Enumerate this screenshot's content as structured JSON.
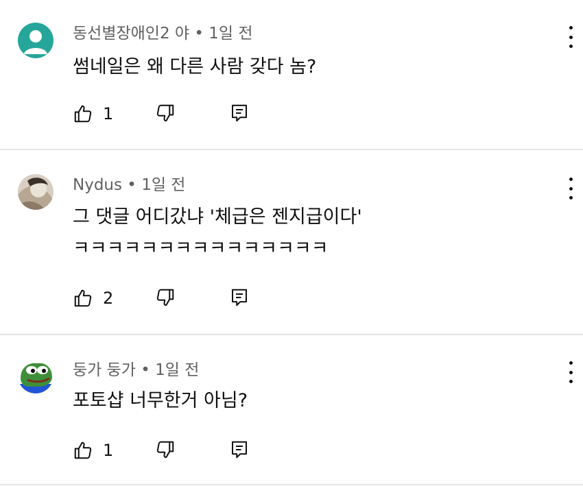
{
  "comments": [
    {
      "author": "동선별장애인2 야",
      "time": "1일 전",
      "lines": [
        "썸네일은 왜 다른 사람 갖다 놈?"
      ],
      "likes": "1",
      "avatar_icon": "default-person-avatar",
      "avatar_color": "#26a69a"
    },
    {
      "author": "Nydus",
      "time": "1일 전",
      "lines": [
        "그 댓글 어디갔냐 '체급은 젠지급이다'",
        "ㅋㅋㅋㅋㅋㅋㅋㅋㅋㅋㅋㅋㅋㅋㅋ"
      ],
      "likes": "2",
      "avatar_icon": "photo-avatar",
      "avatar_color": "#cbbfae"
    },
    {
      "author": "둥가 둥가",
      "time": "1일 전",
      "lines": [
        "포토샵 너무한거 아님?"
      ],
      "likes": "1",
      "avatar_icon": "frog-avatar",
      "avatar_color": "#3f8f3a"
    }
  ],
  "separator": " • "
}
